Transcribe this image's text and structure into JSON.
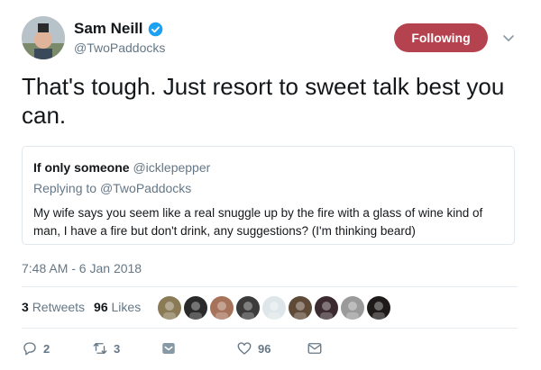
{
  "author": {
    "name": "Sam Neill",
    "handle": "@TwoPaddocks",
    "verified": true
  },
  "follow_button": {
    "label": "Following",
    "color": "#b5434f"
  },
  "tweet": {
    "text": "That's tough. Just resort to sweet talk best you can."
  },
  "quoted_tweet": {
    "author_name": "If only someone",
    "author_handle": "@icklepepper",
    "replying_prefix": "Replying to",
    "replying_to": "@TwoPaddocks",
    "text": "My wife says you seem like a real snuggle up by the fire with a glass of wine kind of man, I have a fire but don't drink, any suggestions? (I'm thinking beard)"
  },
  "timestamp": "7:48 AM - 6 Jan 2018",
  "stats": {
    "retweets_count": "3",
    "retweets_label": "Retweets",
    "likes_count": "96",
    "likes_label": "Likes"
  },
  "liker_avatars": [
    {
      "color": "#8a7a56"
    },
    {
      "color": "#2a2a2a"
    },
    {
      "color": "#a7725a"
    },
    {
      "color": "#3b3b3b"
    },
    {
      "color": "#dfe6ea"
    },
    {
      "color": "#5e4a36"
    },
    {
      "color": "#3b2a30"
    },
    {
      "color": "#9a9a9a"
    },
    {
      "color": "#1e1a1a"
    }
  ],
  "actions": {
    "reply_count": "2",
    "retweet_count": "3",
    "like_count": "96"
  },
  "colors": {
    "accent": "#1da1f2",
    "text_secondary": "#657786",
    "border": "#e1e8ed"
  }
}
